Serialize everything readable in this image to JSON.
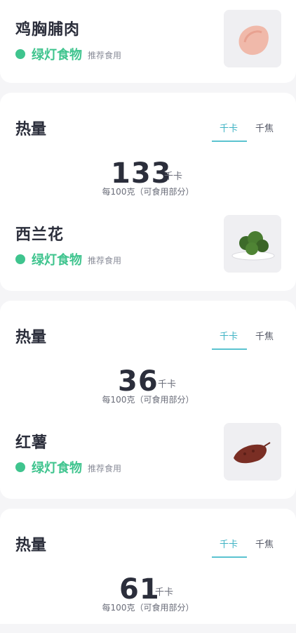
{
  "foods": [
    {
      "name": "鸡胸脯肉",
      "tag": "绿灯食物",
      "tag_sub": "推荐食用",
      "image_icon": "chicken-breast-image"
    },
    {
      "name": "西兰花",
      "tag": "绿灯食物",
      "tag_sub": "推荐食用",
      "image_icon": "broccoli-image"
    },
    {
      "name": "红薯",
      "tag": "绿灯食物",
      "tag_sub": "推荐食用",
      "image_icon": "sweet-potato-image"
    }
  ],
  "calories": [
    {
      "title": "热量",
      "tab_kcal": "千卡",
      "tab_kj": "千焦",
      "value": "133",
      "unit": "千卡",
      "per": "每100克（可食用部分）"
    },
    {
      "title": "热量",
      "tab_kcal": "千卡",
      "tab_kj": "千焦",
      "value": "36",
      "unit": "千卡",
      "per": "每100克（可食用部分）"
    },
    {
      "title": "热量",
      "tab_kcal": "千卡",
      "tab_kj": "千焦",
      "value": "61",
      "unit": "千卡",
      "per": "每100克（可食用部分）"
    }
  ],
  "colors": {
    "green": "#3fc48e",
    "teal": "#5bc3d0",
    "text": "#2b2e3b"
  }
}
